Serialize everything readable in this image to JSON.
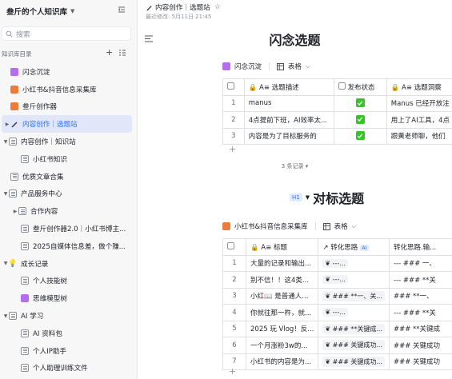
{
  "sidebar": {
    "workspace_title": "叁斤的个人知识库",
    "search_placeholder": "搜索",
    "library_label": "知识库目录",
    "items": [
      {
        "label": "闪念沉淀",
        "icon": "purple-app-icon"
      },
      {
        "label": "小红书&抖音信息采集库",
        "icon": "orange-app-icon"
      },
      {
        "label": "叁斤创作器",
        "icon": "orange-app-icon"
      },
      {
        "label": "内容创作｜选题站",
        "icon": "pen-icon",
        "active": true
      },
      {
        "label": "内容创作｜知识站",
        "icon": "doc-icon",
        "expanded": true
      },
      {
        "label": "小红书知识",
        "icon": "doc-icon"
      },
      {
        "label": "优质文章合集",
        "icon": "doc-icon"
      },
      {
        "label": "产品服务中心",
        "icon": "doc-icon",
        "expanded": true
      },
      {
        "label": "合作内容",
        "icon": "doc-icon"
      },
      {
        "label": "叁斤创作器2.0｜小红书博主...",
        "icon": "doc-icon"
      },
      {
        "label": "2025自媒体信息差，做个赚...",
        "icon": "doc-icon"
      },
      {
        "label": "成长记录",
        "icon": "bulb-icon",
        "expanded": true
      },
      {
        "label": "个人技能树",
        "icon": "doc-icon"
      },
      {
        "label": "思维模型树",
        "icon": "purple-app-icon"
      },
      {
        "label": "AI 学习",
        "icon": "doc-icon",
        "expanded": true
      },
      {
        "label": "AI 资料包",
        "icon": "doc-icon"
      },
      {
        "label": "个人IP助手",
        "icon": "doc-icon"
      },
      {
        "label": "个人助理训练文件",
        "icon": "doc-icon"
      }
    ]
  },
  "main": {
    "breadcrumb": "内容创作｜选题站",
    "modified": "最近修改: 5月11日 21:45",
    "section1": {
      "title": "闪念选题",
      "table_name": "闪念沉淀",
      "view_label": "表格",
      "columns": [
        "选题描述",
        "发布状态",
        "选题洞察"
      ],
      "rows": [
        {
          "idx": "1",
          "desc": "manus",
          "insight": "Manus 已经开放注"
        },
        {
          "idx": "2",
          "desc": "4点提前下班，AI效率太...",
          "insight": "用上了AI工具，4点"
        },
        {
          "idx": "3",
          "desc": "内容是为了目标服务的",
          "insight": "跟黄老师聊，他们"
        }
      ],
      "records": "3 条记录"
    },
    "section2": {
      "tag": "H1",
      "title": "对标选题",
      "table_name": "小红书&抖音信息采集库",
      "view_label": "表格",
      "columns": [
        "标题",
        "转化思路",
        "转化思路.输..."
      ],
      "ai_badge": "AI",
      "rows": [
        {
          "idx": "1",
          "title": "大量的记录和输出...",
          "c2": "---...",
          "c3": "--- ### 一、"
        },
        {
          "idx": "2",
          "title": "别不信！！这4类...",
          "c2": "---...",
          "c3": "--- ### **关"
        },
        {
          "idx": "3",
          "title": "小红📖 是普通人...",
          "c2": "### **一、关...",
          "c3": "### **一、"
        },
        {
          "idx": "4",
          "title": "你就往那一杵，就...",
          "c2": "---...",
          "c3": "--- ### **关"
        },
        {
          "idx": "5",
          "title": "2025 玩 Vlog！反...",
          "c2": "### **关键成...",
          "c3": "### **关键成"
        },
        {
          "idx": "6",
          "title": "一个月涨粉3w的...",
          "c2": "### 关键成功...",
          "c3": "### 关键成功"
        },
        {
          "idx": "7",
          "title": "小红书的内容是为...",
          "c2": "### 关键成功...",
          "c3": "### 关键成功"
        }
      ]
    }
  }
}
